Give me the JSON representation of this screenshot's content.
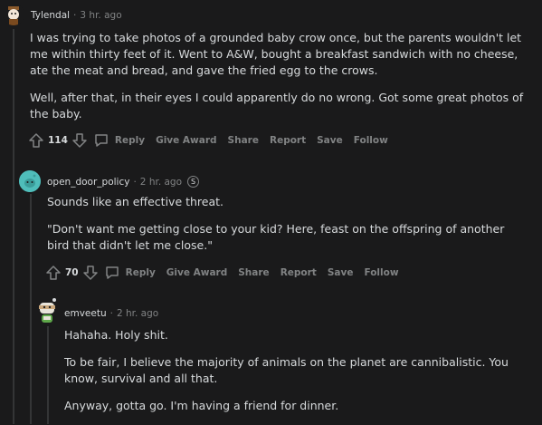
{
  "comments": [
    {
      "author": "Tylendal",
      "time": "3 hr. ago",
      "paragraphs": [
        "I was trying to take photos of a grounded baby crow once, but the parents wouldn't let me within thirty feet of it. Went to A&W, bought a breakfast sandwich with no cheese, ate the meat and bread, and gave the fried egg to the crows.",
        "Well, after that, in their eyes I could apparently do no wrong. Got some great photos of the baby."
      ],
      "score": "114",
      "actions": [
        "Reply",
        "Give Award",
        "Share",
        "Report",
        "Save",
        "Follow"
      ]
    },
    {
      "author": "open_door_policy",
      "time": "2 hr. ago",
      "award_symbol": "S",
      "paragraphs": [
        "Sounds like an effective threat.",
        "\"Don't want me getting close to your kid? Here, feast on the offspring of another bird that didn't let me close.\""
      ],
      "score": "70",
      "actions": [
        "Reply",
        "Give Award",
        "Share",
        "Report",
        "Save",
        "Follow"
      ]
    },
    {
      "author": "emveetu",
      "time": "2 hr. ago",
      "paragraphs": [
        "Hahaha. Holy shit.",
        "To be fair, I believe the majority of animals on the planet are cannibalistic. You know, survival and all that.",
        "Anyway, gotta go. I'm having a friend for dinner."
      ]
    }
  ],
  "separator": "·",
  "colors": {
    "background": "#1a1a1b",
    "text": "#d7dadc",
    "meta": "#818384",
    "thread_line": "#343536",
    "avatar2": "#4fbdba"
  },
  "icons": {
    "upvote": "arrow-up-icon",
    "downvote": "arrow-down-icon",
    "reply": "comment-bubble-icon"
  }
}
